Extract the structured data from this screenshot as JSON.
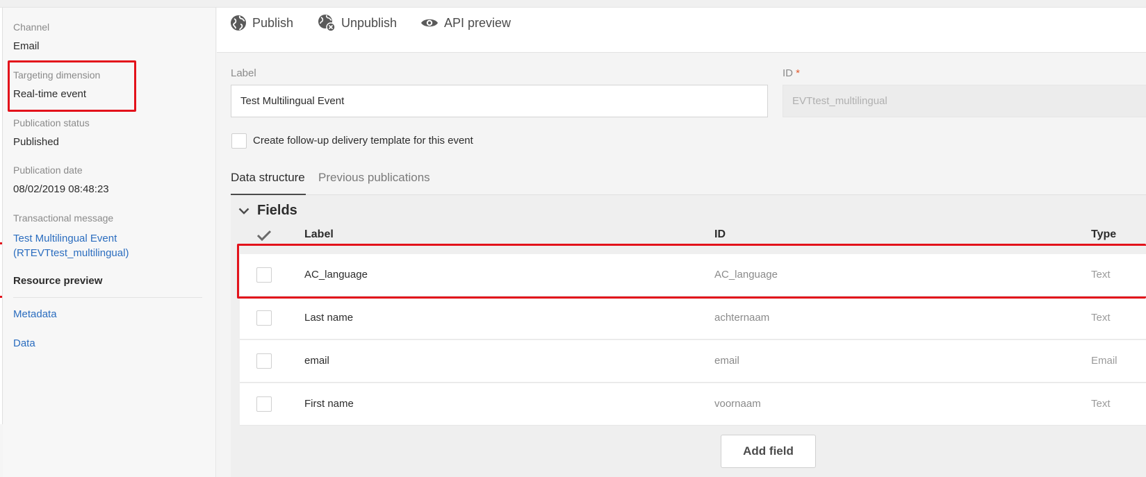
{
  "sidebar": {
    "channel_label": "Channel",
    "channel_value": "Email",
    "targeting_label": "Targeting dimension",
    "targeting_value": "Real-time event",
    "publication_status_label": "Publication status",
    "publication_status_value": "Published",
    "publication_date_label": "Publication date",
    "publication_date_value": "08/02/2019 08:48:23",
    "transactional_label": "Transactional message",
    "transactional_link_line1": "Test Multilingual Event",
    "transactional_link_line2": "(RTEVTtest_multilingual)",
    "resource_preview": "Resource preview",
    "links": [
      "Metadata",
      "Data"
    ]
  },
  "toolbar": {
    "publish_label": "Publish",
    "unpublish_label": "Unpublish",
    "api_preview_label": "API preview"
  },
  "form": {
    "label_caption": "Label",
    "label_value": "Test Multilingual Event",
    "id_caption": "ID",
    "id_required_mark": "*",
    "id_value": "EVTtest_multilingual",
    "followup_checkbox_label": "Create follow-up delivery template for this event",
    "followup_checked": false
  },
  "tabs": [
    {
      "label": "Data structure",
      "active": true
    },
    {
      "label": "Previous publications",
      "active": false
    }
  ],
  "fields": {
    "title": "Fields",
    "columns": {
      "label": "Label",
      "id": "ID",
      "type": "Type"
    },
    "rows": [
      {
        "label": "AC_language",
        "id": "AC_language",
        "type": "Text"
      },
      {
        "label": "Last name",
        "id": "achternaam",
        "type": "Text"
      },
      {
        "label": "email",
        "id": "email",
        "type": "Email"
      },
      {
        "label": "First name",
        "id": "voornaam",
        "type": "Text"
      }
    ],
    "add_button_label": "Add field"
  },
  "colors": {
    "highlight": "#e3121b",
    "link": "#2b6dbf"
  }
}
